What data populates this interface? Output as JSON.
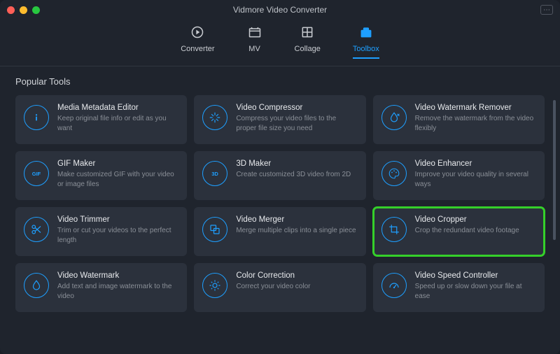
{
  "title": "Vidmore Video Converter",
  "tabs": [
    {
      "id": "converter",
      "label": "Converter",
      "active": false
    },
    {
      "id": "mv",
      "label": "MV",
      "active": false
    },
    {
      "id": "collage",
      "label": "Collage",
      "active": false
    },
    {
      "id": "toolbox",
      "label": "Toolbox",
      "active": true
    }
  ],
  "section_title": "Popular Tools",
  "tools": [
    {
      "id": "media-metadata-editor",
      "name": "Media Metadata Editor",
      "desc": "Keep original file info or edit as you want",
      "icon": "info-icon"
    },
    {
      "id": "video-compressor",
      "name": "Video Compressor",
      "desc": "Compress your video files to the proper file size you need",
      "icon": "compress-icon"
    },
    {
      "id": "video-watermark-remover",
      "name": "Video Watermark Remover",
      "desc": "Remove the watermark from the video flexibly",
      "icon": "droplet-remove-icon"
    },
    {
      "id": "gif-maker",
      "name": "GIF Maker",
      "desc": "Make customized GIF with your video or image files",
      "icon": "gif-icon"
    },
    {
      "id": "3d-maker",
      "name": "3D Maker",
      "desc": "Create customized 3D video from 2D",
      "icon": "3d-icon"
    },
    {
      "id": "video-enhancer",
      "name": "Video Enhancer",
      "desc": "Improve your video quality in several ways",
      "icon": "palette-icon"
    },
    {
      "id": "video-trimmer",
      "name": "Video Trimmer",
      "desc": "Trim or cut your videos to the perfect length",
      "icon": "scissors-icon"
    },
    {
      "id": "video-merger",
      "name": "Video Merger",
      "desc": "Merge multiple clips into a single piece",
      "icon": "merge-icon"
    },
    {
      "id": "video-cropper",
      "name": "Video Cropper",
      "desc": "Crop the redundant video footage",
      "icon": "crop-icon",
      "highlight": true
    },
    {
      "id": "video-watermark",
      "name": "Video Watermark",
      "desc": "Add text and image watermark to the video",
      "icon": "droplet-icon"
    },
    {
      "id": "color-correction",
      "name": "Color Correction",
      "desc": "Correct your video color",
      "icon": "sun-icon"
    },
    {
      "id": "video-speed-controller",
      "name": "Video Speed Controller",
      "desc": "Speed up or slow down your file at ease",
      "icon": "speedometer-icon"
    }
  ],
  "colors": {
    "accent": "#1e9fff",
    "highlight": "#35d02a",
    "bg": "#1f242d",
    "card": "#2b313c"
  }
}
